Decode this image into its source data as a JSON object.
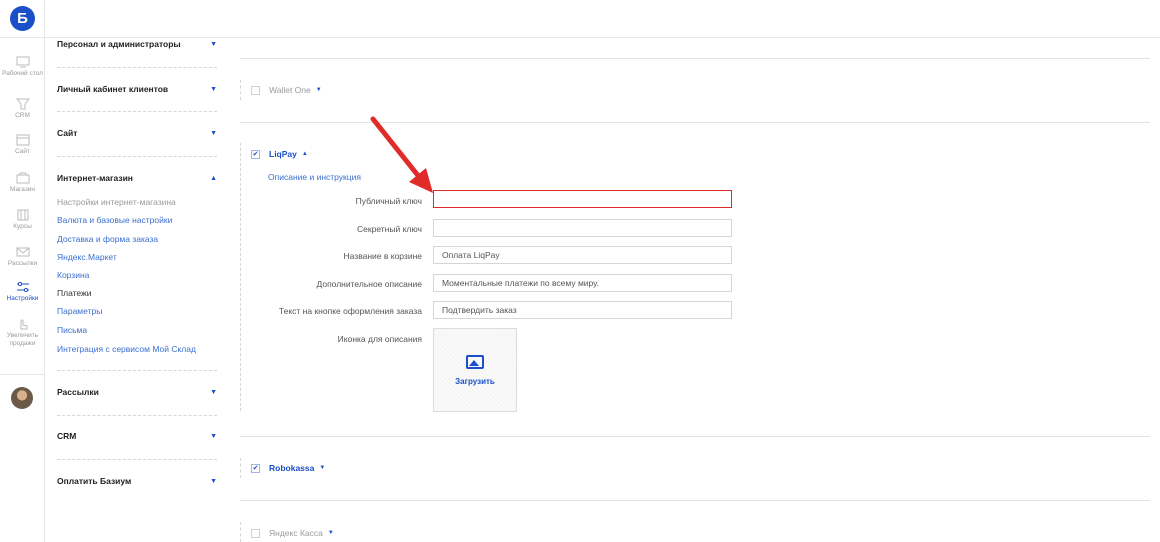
{
  "rail": {
    "logo": "Б",
    "items": [
      {
        "label": "Рабочий стол",
        "icon": "monitor-icon"
      },
      {
        "label": "CRM",
        "icon": "funnel-icon"
      },
      {
        "label": "Сайт",
        "icon": "site-icon"
      },
      {
        "label": "Магазин",
        "icon": "cart-icon"
      },
      {
        "label": "Курсы",
        "icon": "courses-icon"
      },
      {
        "label": "Рассылки",
        "icon": "mail-icon"
      },
      {
        "label": "Настройки",
        "icon": "sliders-icon"
      },
      {
        "label": "Увеличить продажи",
        "icon": "hand-icon"
      }
    ]
  },
  "nav": {
    "groups": [
      {
        "label": "Персонал и администраторы"
      },
      {
        "label": "Личный кабинет клиентов"
      },
      {
        "label": "Сайт"
      },
      {
        "label": "Интернет-магазин"
      },
      {
        "label": "Рассылки"
      },
      {
        "label": "CRM"
      },
      {
        "label": "Оплатить Базиум"
      }
    ],
    "shop_items": [
      "Настройки интернет-магазина",
      "Валюта и базовые настройки",
      "Доставка и форма заказа",
      "Яндекс.Маркет",
      "Корзина",
      "Платежи",
      "Параметры",
      "Письма",
      "Интеграция с сервисом Мой Склад"
    ]
  },
  "payments": {
    "wallet_one": "Wallet One",
    "liqpay": "LiqPay",
    "robokassa": "Robokassa",
    "yandex_kassa": "Яндекс Касса",
    "desc_link": "Описание и инструкция",
    "check": "✔"
  },
  "liqpay_form": {
    "public_key_label": "Публичный ключ",
    "public_key_value": "",
    "secret_key_label": "Секретный ключ",
    "secret_key_value": "",
    "cart_name_label": "Название в корзине",
    "cart_name_value": "Оплата LiqPay",
    "extra_desc_label": "Дополнительное описание",
    "extra_desc_value": "Моментальные платежи по всему миру.",
    "button_text_label": "Текст на кнопке оформления заказа",
    "button_text_value": "Подтвердить заказ",
    "icon_label": "Иконка для описания",
    "upload_label": "Загрузить"
  },
  "colors": {
    "accent": "#1a4fc9",
    "highlight": "#e02b2b"
  }
}
